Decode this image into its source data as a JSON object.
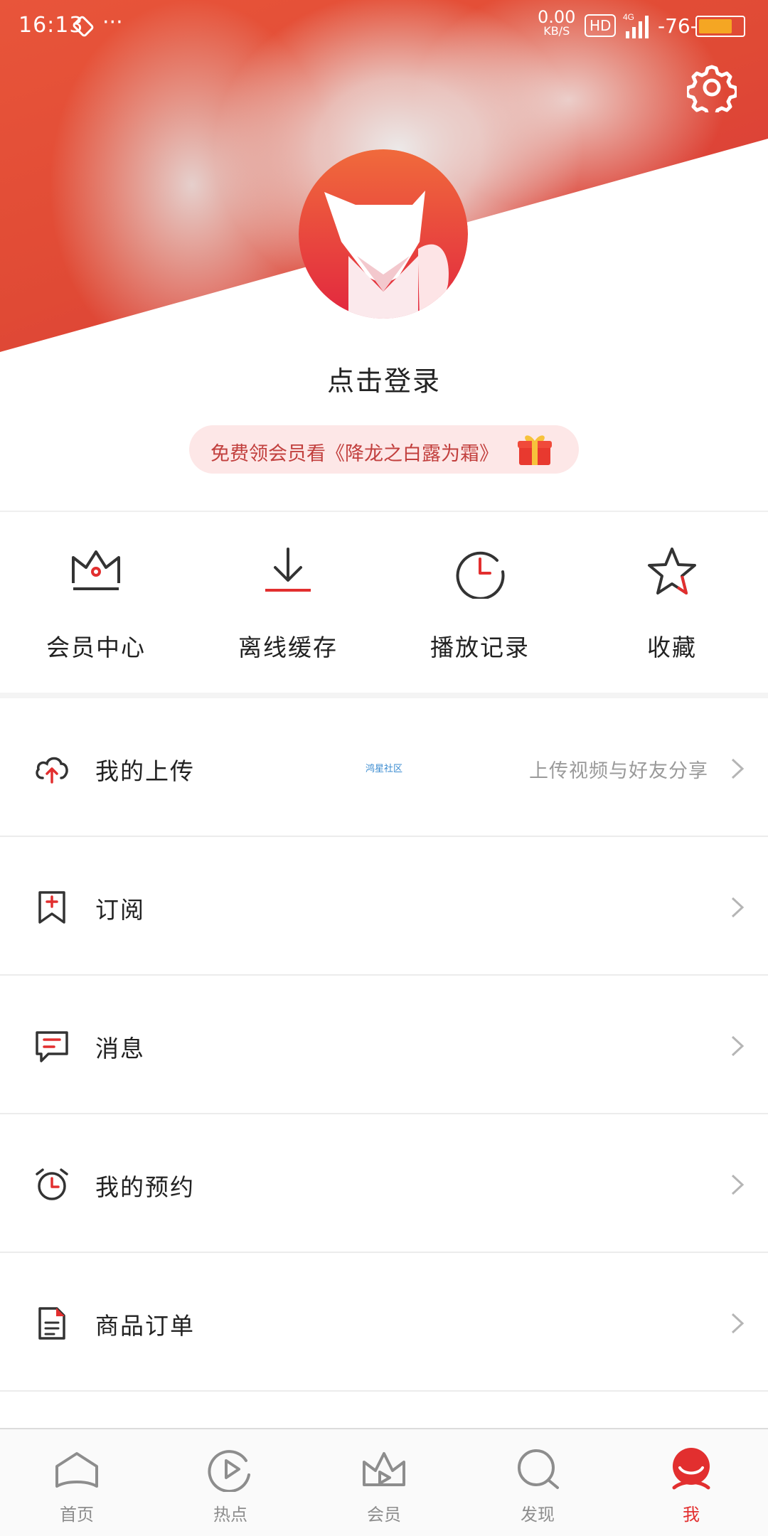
{
  "status_bar": {
    "time": "16:13",
    "more": "···",
    "net_speed_value": "0.00",
    "net_speed_unit": "KB/S",
    "hd": "HD",
    "network": "4G",
    "battery_text": "-76-",
    "battery_level": 0.76
  },
  "header": {
    "login_label": "点击登录",
    "promo_text": "免费领会员看《降龙之白露为霜》"
  },
  "quick_actions": [
    {
      "label": "会员中心",
      "icon": "crown-icon"
    },
    {
      "label": "离线缓存",
      "icon": "download-icon"
    },
    {
      "label": "播放记录",
      "icon": "history-clock-icon"
    },
    {
      "label": "收藏",
      "icon": "star-icon"
    }
  ],
  "menu": [
    {
      "label": "我的上传",
      "hint": "上传视频与好友分享",
      "icon": "cloud-upload-icon"
    },
    {
      "label": "订阅",
      "hint": "",
      "icon": "bookmark-add-icon"
    },
    {
      "label": "消息",
      "hint": "",
      "icon": "message-icon"
    },
    {
      "label": "我的预约",
      "hint": "",
      "icon": "alarm-clock-icon"
    },
    {
      "label": "商品订单",
      "hint": "",
      "icon": "order-document-icon"
    }
  ],
  "watermark": "鸿星社区",
  "tabs": [
    {
      "label": "首页",
      "icon": "home-icon",
      "active": false
    },
    {
      "label": "热点",
      "icon": "play-circle-icon",
      "active": false
    },
    {
      "label": "会员",
      "icon": "vip-crown-icon",
      "active": false
    },
    {
      "label": "发现",
      "icon": "search-discover-icon",
      "active": false
    },
    {
      "label": "我",
      "icon": "profile-icon",
      "active": true
    }
  ],
  "colors": {
    "accent": "#e22f2f",
    "header_red": "#e04a35",
    "promo_bg": "#fde7e7",
    "promo_text": "#c2403e",
    "hint_gray": "#9a9a9a"
  }
}
